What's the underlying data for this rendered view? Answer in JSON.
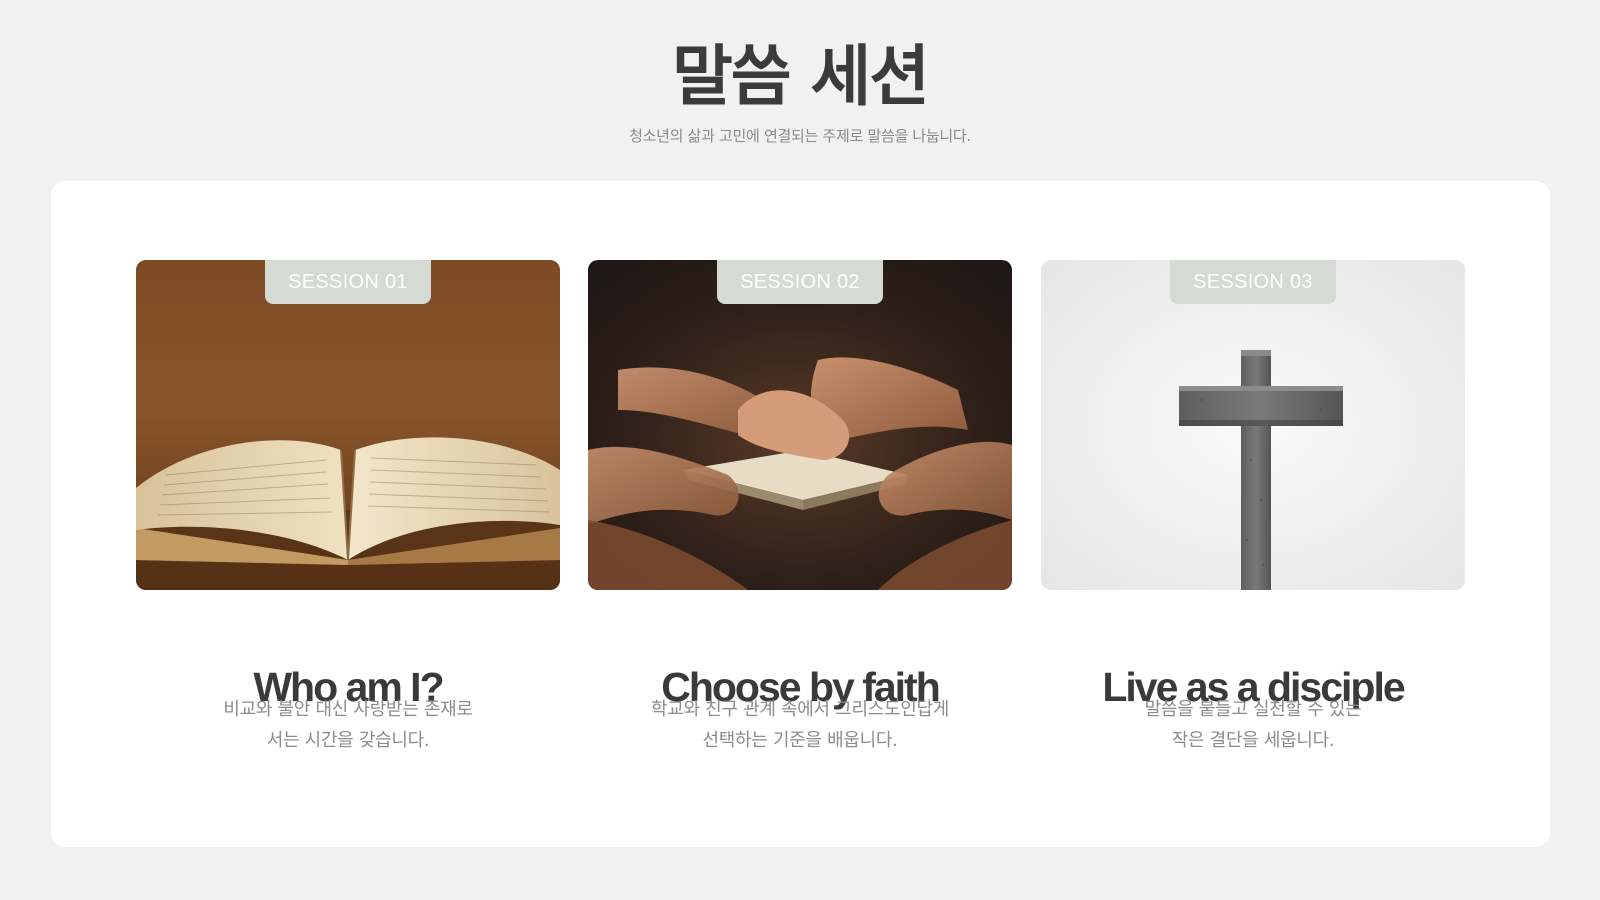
{
  "header": {
    "title": "말씀 세션",
    "subtitle": "청소년의 삶과 고민에 연결되는 주제로 말씀을 나눕니다."
  },
  "sessions": [
    {
      "badge": "SESSION 01",
      "image_icon": "open-bible-photo",
      "title": "Who am I?",
      "desc_line1": "비교와 불안 대신 사랑받는 존재로",
      "desc_line2": "서는 시간을 갖습니다."
    },
    {
      "badge": "SESSION 02",
      "image_icon": "praying-hands-photo",
      "title": "Choose by faith",
      "desc_line1": "학교와 친구 관계 속에서 그리스도인답게",
      "desc_line2": "선택하는 기준을 배웁니다."
    },
    {
      "badge": "SESSION 03",
      "image_icon": "stone-cross-photo",
      "title": "Live as a disciple",
      "desc_line1": "말씀을 붙들고 실천할 수 있는",
      "desc_line2": "작은 결단을 세웁니다."
    }
  ],
  "colors": {
    "background": "#f1f1f1",
    "panel": "#ffffff",
    "badge": "#d5dad4",
    "title_text": "#3a3a3a",
    "body_text": "#8c8c8c"
  }
}
